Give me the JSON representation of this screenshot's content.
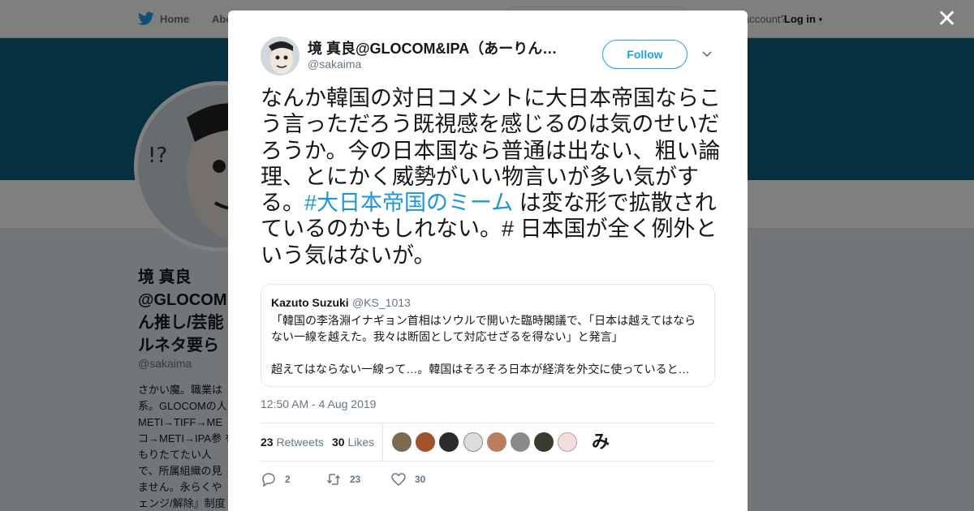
{
  "topnav": {
    "home_label": "Home",
    "about_label": "Abo",
    "account_text": "account?",
    "login_label": "Log in"
  },
  "profile": {
    "name": "境 真良 @GLOCOM ん推し/芸能 ルネタ要ら",
    "handle": "@sakaima",
    "bio": "さかい魔。職業は 系。GLOCOMの人 METI→TIFF→ME コ→METI→IPA参 をもりたてたい人 で、所属組織の見 ません。永らくや ェンジ/解除』制度"
  },
  "tweet": {
    "display_name": "境 真良@GLOCOM&IPA（あーりん…",
    "handle": "@sakaima",
    "follow_label": "Follow",
    "text_before": "なんか韓国の対日コメントに大日本帝国ならこう言っただろう既視感を感じるのは気のせいだろうか。今の日本国なら普通は出ない、粗い論理、とにかく威勢がいい物言いが多い気がする。",
    "hashtag": "#大日本帝国のミーム",
    "text_after": " は変な形で拡散されているのかもしれない。# 日本国が全く例外という気はないが。",
    "timestamp": "12:50 AM - 4 Aug 2019"
  },
  "quote": {
    "name": "Kazuto Suzuki",
    "handle": "@KS_1013",
    "text": "「韓国の李洛淵イナギョン首相はソウルで開いた臨時閣議で、「日本は越えてはならない一線を越えた。我々は断固として対応せざるを得ない」と発言」",
    "text2": "超えてはならない一線って…。韓国はそろそろ日本が経済を外交に使っていると…"
  },
  "stats": {
    "retweets_count": "23",
    "retweets_label": "Retweets",
    "likes_count": "30",
    "likes_label": "Likes",
    "last_face_char": "み"
  },
  "actions": {
    "reply_count": "2",
    "retweet_count": "23",
    "like_count": "30"
  },
  "colors": {
    "brand": "#1da1f2",
    "hashtag": "#1b95e0",
    "banner": "#0d5e80"
  }
}
